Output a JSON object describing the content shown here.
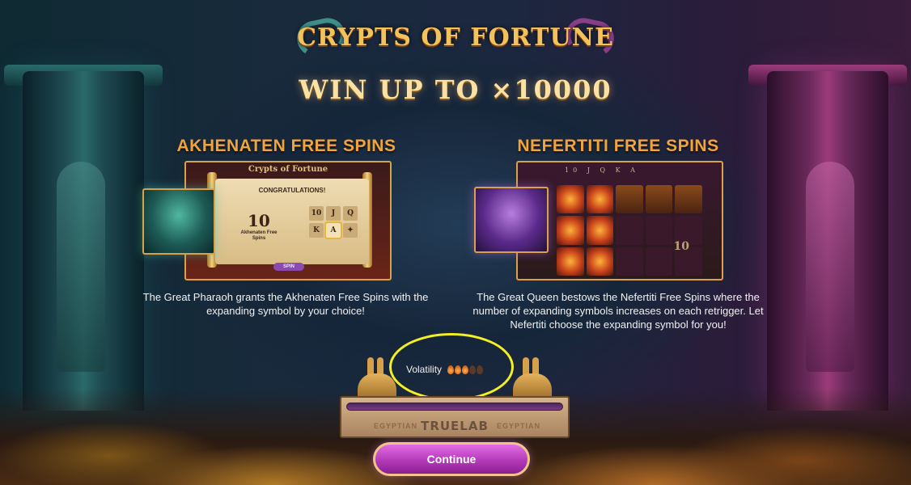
{
  "logo": {
    "title": "CRYPTS OF FORTUNE"
  },
  "headline": "WIN UP TO ×10000",
  "features": [
    {
      "title": "AKHENATEN FREE SPINS",
      "description": "The Great Pharaoh grants the Akhenaten Free Spins with the expanding symbol by your choice!",
      "preview": {
        "logo": "Crypts of Fortune",
        "heading": "CONGRATULATIONS!",
        "won_count": "10",
        "won_label": "Akhenaten Free Spins",
        "symbols": [
          "10",
          "J",
          "Q",
          "K",
          "A",
          "✦"
        ],
        "button": "SPIN"
      }
    },
    {
      "title": "NEFERTITI FREE SPINS",
      "description": "The Great Queen bestows the Nefertiti Free Spins where the number of expanding symbols increases on each retrigger. Let Nefertiti choose the expanding symbol for you!",
      "preview": {
        "top_symbols": "10 J Q K A",
        "reel_number": "10"
      }
    }
  ],
  "volatility": {
    "label": "Volatility",
    "level": 3,
    "max": 5,
    "color_on": "#e8892a",
    "color_off": "#5a3a28"
  },
  "pedestal": {
    "brand": "TRUELAB",
    "left_mark": "EGYPTIAN",
    "right_mark": "EGYPTIAN"
  },
  "continue_label": "Continue",
  "highlight_color": "#f4ef22"
}
